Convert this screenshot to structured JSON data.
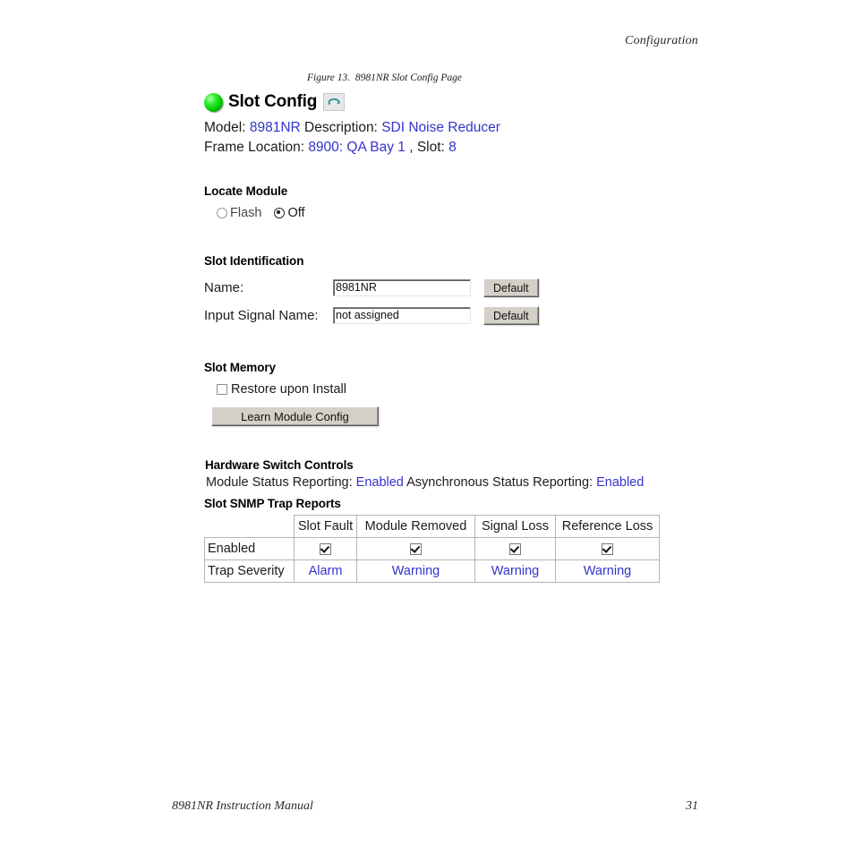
{
  "page": {
    "header_text": "Configuration",
    "footer_left": "8981NR Instruction Manual",
    "footer_right": "31",
    "figure_caption": "Figure 13.  8981NR Slot Config Page"
  },
  "colors": {
    "link_blue": "#3333cc",
    "led_green": "#00c800",
    "refresh_teal": "#1f8c8c",
    "button_face": "#d4d0c8"
  },
  "panel": {
    "title": "Slot Config",
    "status_led": "green-status-led",
    "refresh_icon": "refresh-icon",
    "model_label": "Model:",
    "model_value": "8981NR",
    "description_label": "Description:",
    "description_value": "SDI Noise Reducer",
    "frame_location_label": "Frame Location:",
    "frame_location_value": "8900: QA Bay 1",
    "slot_label": ", Slot:",
    "slot_value": "8"
  },
  "locate_module": {
    "heading": "Locate Module",
    "options": [
      {
        "label": "Flash",
        "selected": false
      },
      {
        "label": "Off",
        "selected": true
      }
    ]
  },
  "slot_identification": {
    "heading": "Slot Identification",
    "fields": [
      {
        "label": "Name:",
        "value": "8981NR",
        "placeholder": "",
        "button_label": "Default"
      },
      {
        "label": "Input Signal Name:",
        "value": "not assigned",
        "placeholder": "",
        "button_label": "Default"
      }
    ]
  },
  "slot_memory": {
    "heading": "Slot Memory",
    "restore_label": "Restore upon Install",
    "restore_checked": false,
    "learn_button_label": "Learn Module Config"
  },
  "hardware_switch_controls": {
    "heading": "Hardware Switch Controls",
    "module_status_label": "Module Status Reporting:",
    "module_status_value": "Enabled",
    "async_status_label": "Asynchronous Status Reporting:",
    "async_status_value": "Enabled"
  },
  "snmp_trap_reports": {
    "heading": "Slot SNMP Trap Reports",
    "columns": [
      "",
      "Slot Fault",
      "Module Removed",
      "Signal Loss",
      "Reference Loss"
    ],
    "rows": [
      {
        "label": "Enabled",
        "values": [
          true,
          true,
          true,
          true
        ]
      },
      {
        "label": "Trap Severity",
        "values": [
          "Alarm",
          "Warning",
          "Warning",
          "Warning"
        ]
      }
    ]
  }
}
